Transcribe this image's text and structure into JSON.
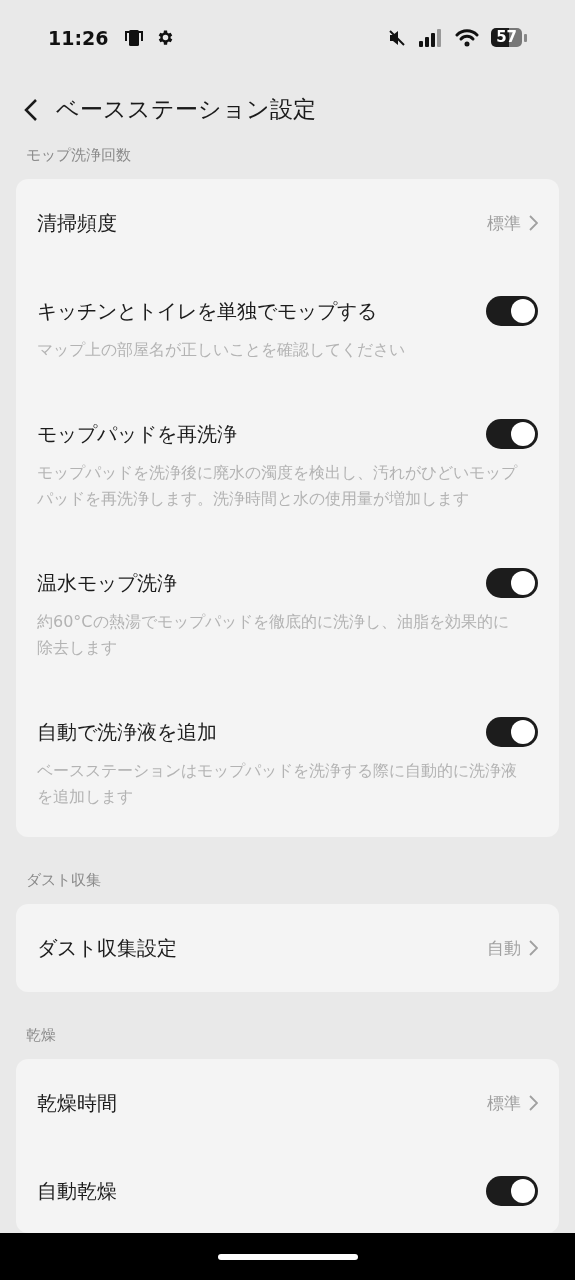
{
  "status_bar": {
    "time": "11:26",
    "battery": "57"
  },
  "header": {
    "title": "ベースステーション設定"
  },
  "sections": [
    {
      "label": "モップ洗浄回数",
      "rows": [
        {
          "kind": "value",
          "label": "清掃頻度",
          "value": "標準"
        },
        {
          "kind": "toggle",
          "label": "キッチンとトイレを単独でモップする",
          "on": true,
          "description": "マップ上の部屋名が正しいことを確認してください"
        },
        {
          "kind": "toggle",
          "label": "モップパッドを再洗浄",
          "on": true,
          "description": "モップパッドを洗浄後に廃水の濁度を検出し、汚れがひどいモップパッドを再洗浄します。洗浄時間と水の使用量が増加します"
        },
        {
          "kind": "toggle",
          "label": "温水モップ洗浄",
          "on": true,
          "description": "約60°Cの熱湯でモップパッドを徹底的に洗浄し、油脂を効果的に除去します"
        },
        {
          "kind": "toggle",
          "label": "自動で洗浄液を追加",
          "on": true,
          "description": "ベースステーションはモップパッドを洗浄する際に自動的に洗浄液を追加します"
        }
      ]
    },
    {
      "label": "ダスト収集",
      "rows": [
        {
          "kind": "value",
          "label": "ダスト収集設定",
          "value": "自動"
        }
      ]
    },
    {
      "label": "乾燥",
      "rows": [
        {
          "kind": "value",
          "label": "乾燥時間",
          "value": "標準"
        },
        {
          "kind": "toggle",
          "label": "自動乾燥",
          "on": true
        }
      ]
    }
  ]
}
